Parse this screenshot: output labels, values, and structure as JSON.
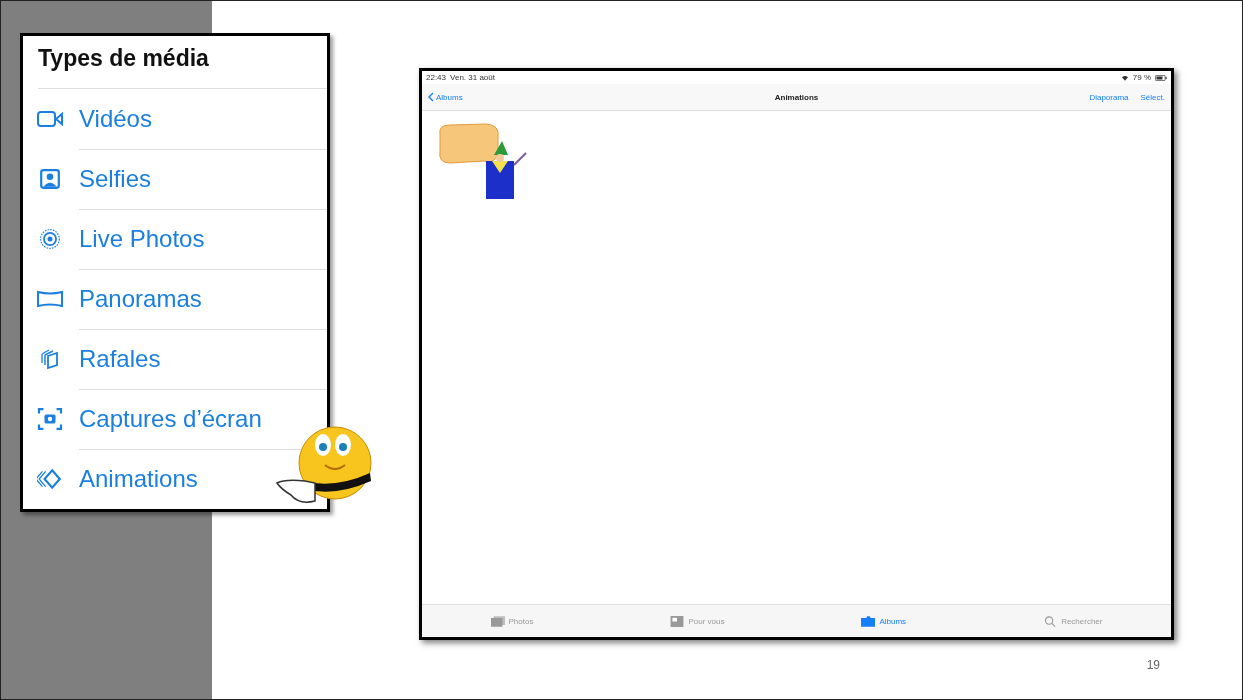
{
  "panel": {
    "title": "Types de média",
    "items": [
      {
        "label": "Vidéos",
        "kind": "video"
      },
      {
        "label": "Selfies",
        "kind": "selfie"
      },
      {
        "label": "Live Photos",
        "kind": "live"
      },
      {
        "label": "Panoramas",
        "kind": "panorama"
      },
      {
        "label": "Rafales",
        "kind": "burst"
      },
      {
        "label": "Captures d’écran",
        "kind": "screenshot"
      },
      {
        "label": "Animations",
        "kind": "animation"
      }
    ]
  },
  "ipad": {
    "status_bar": {
      "time": "22:43",
      "date": "Ven. 31 août",
      "battery": "79 %"
    },
    "nav": {
      "back": "Albums",
      "title": "Animations",
      "actions": [
        "Diaporama",
        "Sélect."
      ]
    },
    "tabs": [
      {
        "label": "Photos",
        "kind": "photos",
        "selected": false
      },
      {
        "label": "Pour vous",
        "kind": "foryou",
        "selected": false
      },
      {
        "label": "Albums",
        "kind": "albums",
        "selected": true
      },
      {
        "label": "Rechercher",
        "kind": "search",
        "selected": false
      }
    ]
  },
  "slide_number": "19"
}
